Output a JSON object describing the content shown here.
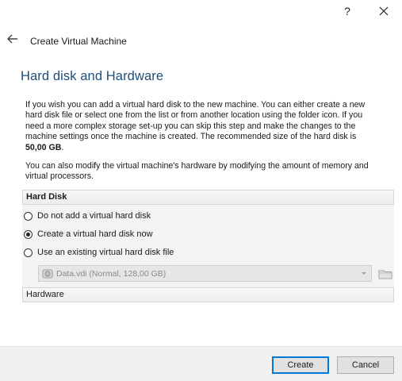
{
  "window": {
    "help_label": "?",
    "close_icon": "close-icon"
  },
  "header": {
    "back_icon": "back-arrow-icon",
    "wizard_title": "Create Virtual Machine",
    "page_heading": "Hard disk and Hardware"
  },
  "description": {
    "para1_text": "If you wish you can add a virtual hard disk to the new machine. You can either create a new hard disk file or select one from the list or from another location using the folder icon. If you need a more complex storage set-up you can skip this step and make the changes to the machine settings once the machine is created. The recommended size of the hard disk is ",
    "para1_bold": "50,00 GB",
    "para1_end": ".",
    "para2_text": "You can also modify the virtual machine's hardware by modifying the amount of memory and virtual processors."
  },
  "hard_disk": {
    "section_label": "Hard Disk",
    "options": [
      {
        "label": "Do not add a virtual hard disk",
        "selected": false
      },
      {
        "label": "Create a virtual hard disk now",
        "selected": true
      },
      {
        "label": "Use an existing virtual hard disk file",
        "selected": false
      }
    ],
    "existing_disk_value": "Data.vdi (Normal, 128,00 GB)",
    "folder_icon": "folder-icon"
  },
  "hardware": {
    "section_label": "Hardware"
  },
  "buttons": {
    "create_label": "Create",
    "cancel_label": "Cancel"
  },
  "colors": {
    "heading": "#1f4e79",
    "default_button_border": "#0078d7"
  }
}
